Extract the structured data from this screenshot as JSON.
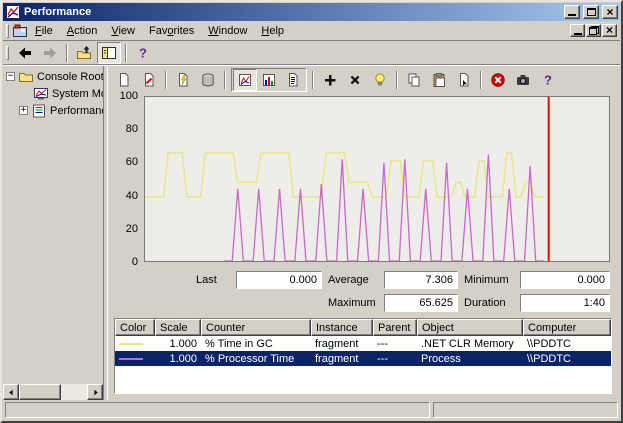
{
  "window": {
    "title": "Performance"
  },
  "titlebar": {
    "controls": [
      "minimize",
      "maximize",
      "close"
    ]
  },
  "menubar": {
    "items": [
      {
        "label": "File",
        "underline": 0
      },
      {
        "label": "Action",
        "underline": 0
      },
      {
        "label": "View",
        "underline": 0
      },
      {
        "label": "Favorites",
        "underline": 3
      },
      {
        "label": "Window",
        "underline": 0
      },
      {
        "label": "Help",
        "underline": 0
      }
    ],
    "child_controls": [
      "minimize",
      "restore",
      "close"
    ]
  },
  "nav_toolbar": {
    "groups": [
      {
        "buttons": [
          {
            "name": "back"
          },
          {
            "name": "forward",
            "disabled": true
          }
        ]
      },
      {
        "buttons": [
          {
            "name": "up-level"
          },
          {
            "name": "show-hide-tree",
            "pressed": true
          }
        ]
      },
      {
        "buttons": [
          {
            "name": "help"
          }
        ]
      }
    ]
  },
  "tree": {
    "items": [
      {
        "label": "Console Root",
        "icon": "folder",
        "level": 0,
        "expander": "minus"
      },
      {
        "label": "System Mo",
        "icon": "system-monitor",
        "level": 1,
        "expander": "none"
      },
      {
        "label": "Performanc",
        "icon": "perf-logs",
        "level": 1,
        "expander": "plus"
      }
    ]
  },
  "perfmon_toolbar": {
    "groups": [
      {
        "buttons": [
          "new-counter-set",
          "clear-display"
        ]
      },
      {
        "buttons": [
          "view-current-activity",
          "view-log-data"
        ]
      },
      {
        "boxed": true,
        "pressed": "view-graph",
        "buttons": [
          "view-graph",
          "view-histogram",
          "view-report"
        ]
      },
      {
        "buttons": [
          "add-counter",
          "delete-counter",
          "highlight"
        ]
      },
      {
        "buttons": [
          "copy-properties",
          "paste-counter-list",
          "properties"
        ]
      },
      {
        "buttons": [
          "freeze-display",
          "update-data",
          "context-help"
        ]
      }
    ]
  },
  "stats": {
    "last_label": "Last",
    "last_value": "0.000",
    "average_label": "Average",
    "average_value": "7.306",
    "minimum_label": "Minimum",
    "minimum_value": "0.000",
    "maximum_label": "Maximum",
    "maximum_value": "65.625",
    "duration_label": "Duration",
    "duration_value": "1:40"
  },
  "counter_table": {
    "headers": [
      "Color",
      "Scale",
      "Counter",
      "Instance",
      "Parent",
      "Object",
      "Computer"
    ],
    "rows": [
      {
        "color": "#e6e67a",
        "scale": "1.000",
        "counter": "% Time in GC",
        "instance": "fragment",
        "parent": "---",
        "object": ".NET CLR Memory",
        "computer": "\\\\PDDTC",
        "selected": false
      },
      {
        "color": "#cc66cc",
        "scale": "1.000",
        "counter": "% Processor Time",
        "instance": "fragment",
        "parent": "---",
        "object": "Process",
        "computer": "\\\\PDDTC",
        "selected": true
      }
    ]
  },
  "chart_data": {
    "type": "line",
    "title": "",
    "xlabel": "",
    "ylabel": "",
    "ylim": [
      0,
      100
    ],
    "yticks": [
      100,
      80,
      60,
      40,
      20,
      0
    ],
    "grid": false,
    "legend_position": "table-below",
    "timeline_position": 87,
    "timeline_color": "#ff0000",
    "series": [
      {
        "name": "% Time in GC",
        "color": "#e6e67a",
        "points": [
          [
            0,
            39
          ],
          [
            4,
            39
          ],
          [
            5,
            66
          ],
          [
            8,
            66
          ],
          [
            9,
            39
          ],
          [
            12,
            39
          ],
          [
            13,
            66
          ],
          [
            19,
            66
          ],
          [
            20,
            48
          ],
          [
            24,
            48
          ],
          [
            25,
            66
          ],
          [
            31,
            66
          ],
          [
            32,
            39
          ],
          [
            38,
            39
          ],
          [
            39,
            66
          ],
          [
            43,
            66
          ],
          [
            44,
            48
          ],
          [
            48,
            48
          ],
          [
            49,
            39
          ],
          [
            52,
            39
          ],
          [
            53,
            61
          ],
          [
            55,
            61
          ],
          [
            56,
            39
          ],
          [
            59,
            39
          ],
          [
            60,
            61
          ],
          [
            62,
            61
          ],
          [
            63,
            39
          ],
          [
            66,
            39
          ],
          [
            67,
            48
          ],
          [
            68,
            48
          ],
          [
            69,
            39
          ],
          [
            71,
            39
          ],
          [
            72,
            61
          ],
          [
            73,
            61
          ],
          [
            74,
            39
          ],
          [
            77,
            39
          ],
          [
            78,
            66
          ],
          [
            79,
            66
          ],
          [
            80,
            39
          ],
          [
            81,
            39
          ],
          [
            82,
            48
          ],
          [
            83,
            48
          ],
          [
            84,
            39
          ],
          [
            86,
            39
          ]
        ]
      },
      {
        "name": "% Processor Time",
        "color": "#cc66cc",
        "points": [
          [
            17,
            0
          ],
          [
            18.8,
            0
          ],
          [
            20,
            44
          ],
          [
            21.2,
            0
          ],
          [
            23.3,
            0
          ],
          [
            24.5,
            44
          ],
          [
            25.7,
            0
          ],
          [
            27.8,
            0
          ],
          [
            29,
            44
          ],
          [
            30.2,
            0
          ],
          [
            32.3,
            0
          ],
          [
            33.5,
            44
          ],
          [
            34.7,
            0
          ],
          [
            36.8,
            0
          ],
          [
            38,
            47
          ],
          [
            39.2,
            0
          ],
          [
            41.3,
            0
          ],
          [
            42.5,
            62
          ],
          [
            43.7,
            0
          ],
          [
            45.8,
            0
          ],
          [
            47,
            44
          ],
          [
            48.2,
            0
          ],
          [
            50.3,
            0
          ],
          [
            51.5,
            60
          ],
          [
            52.7,
            0
          ],
          [
            54.8,
            0
          ],
          [
            56,
            62
          ],
          [
            57.2,
            0
          ],
          [
            59.3,
            0
          ],
          [
            60.5,
            44
          ],
          [
            61.7,
            0
          ],
          [
            63.8,
            0
          ],
          [
            65,
            60
          ],
          [
            66.2,
            0
          ],
          [
            68.3,
            0
          ],
          [
            69.5,
            44
          ],
          [
            70.7,
            0
          ],
          [
            72.8,
            0
          ],
          [
            74,
            65
          ],
          [
            75.2,
            0
          ],
          [
            77.3,
            0
          ],
          [
            78.5,
            44
          ],
          [
            79.7,
            0
          ],
          [
            81.8,
            0
          ],
          [
            83,
            58
          ],
          [
            84.2,
            0
          ],
          [
            86,
            0
          ]
        ]
      }
    ]
  },
  "statusbar": {
    "left_text": "",
    "right_text": ""
  }
}
